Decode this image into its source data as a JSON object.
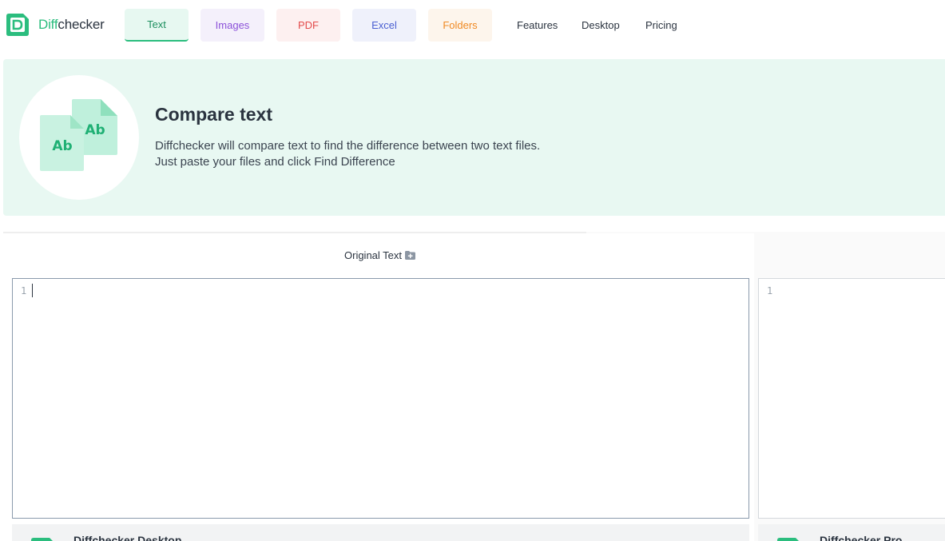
{
  "brand": {
    "name_accent": "Diff",
    "name_rest": "checker",
    "accent_color": "#2bbd7e"
  },
  "tabs": [
    {
      "label": "Text",
      "active": true,
      "color": "#1e8f5f"
    },
    {
      "label": "Images",
      "color": "#8c52d9"
    },
    {
      "label": "PDF",
      "color": "#e34c4c"
    },
    {
      "label": "Excel",
      "color": "#4a5fd1"
    },
    {
      "label": "Folders",
      "color": "#f08a24"
    }
  ],
  "nav": {
    "features": "Features",
    "desktop": "Desktop",
    "pricing": "Pricing"
  },
  "hero": {
    "icon_text_back": "Ab",
    "icon_text_front": "Ab",
    "title": "Compare text",
    "desc_line1": "Diffchecker will compare text to find the difference between two text files.",
    "desc_line2": "Just paste your files and click Find Difference"
  },
  "editor": {
    "left_title": "Original Text",
    "left_title_icon": "add-file-icon",
    "left_line_number": "1",
    "right_line_number": "1"
  },
  "promos": {
    "left": "Diffchecker Desktop",
    "right": "Diffchecker Pro"
  }
}
